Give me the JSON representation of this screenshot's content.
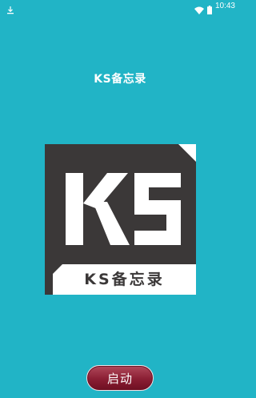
{
  "status_bar": {
    "time": "10:43",
    "left_icon": "download-icon",
    "right_icons": [
      "wifi-icon",
      "battery-icon"
    ]
  },
  "app": {
    "title": "KS备忘录"
  },
  "logo": {
    "letters": "KS",
    "caption": "KS备忘录"
  },
  "launch": {
    "label": "启动"
  },
  "colors": {
    "background": "#21b4c6",
    "logo_dark": "#3b3838",
    "button": "#8a1e33"
  }
}
